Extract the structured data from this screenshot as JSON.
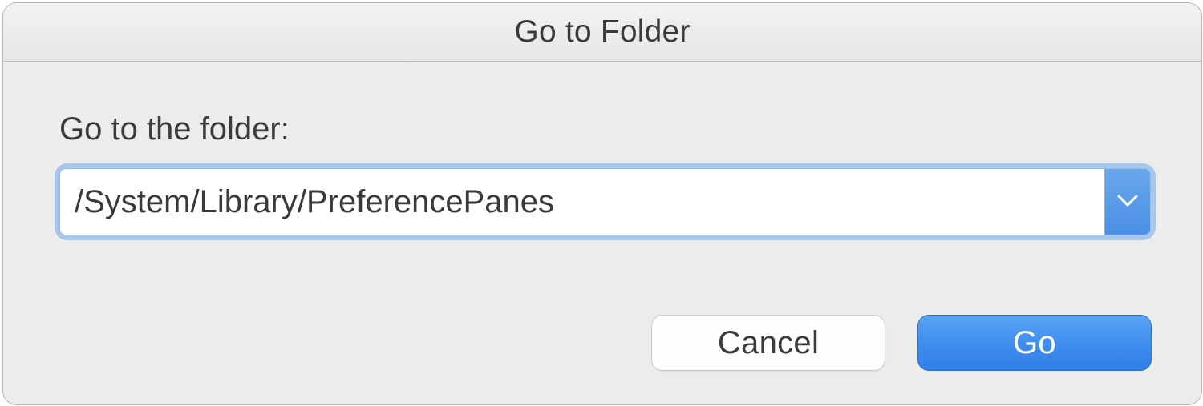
{
  "dialog": {
    "title": "Go to Folder",
    "prompt": "Go to the folder:",
    "path_value": "/System/Library/PreferencePanes"
  },
  "buttons": {
    "cancel": "Cancel",
    "go": "Go"
  },
  "icons": {
    "dropdown": "chevron-down"
  },
  "colors": {
    "accent": "#3d8df0",
    "focus_ring": "#6da8ed"
  }
}
